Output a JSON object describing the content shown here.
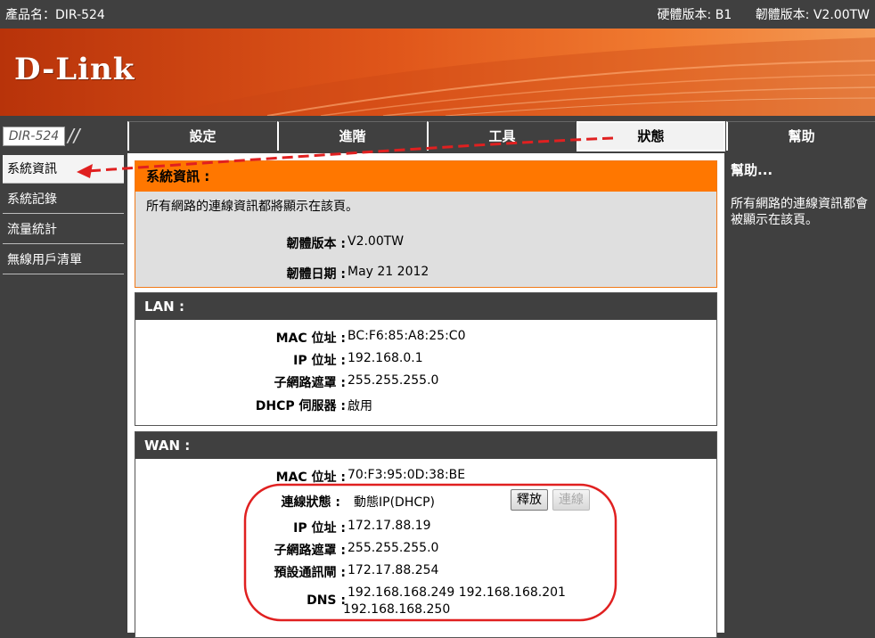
{
  "topbar": {
    "product_name": "產品名：DIR-524",
    "hardware_version": "硬體版本: B1",
    "firmware_version": "韌體版本: V2.00TW"
  },
  "brand": {
    "logo": "D-Link",
    "model_tag": "DIR-524"
  },
  "nav": {
    "tabs": [
      {
        "label": "設定"
      },
      {
        "label": "進階"
      },
      {
        "label": "工具"
      },
      {
        "label": "狀態"
      },
      {
        "label": "幫助"
      }
    ]
  },
  "sidebar": {
    "items": [
      {
        "label": "系統資訊"
      },
      {
        "label": "系統記錄"
      },
      {
        "label": "流量統計"
      },
      {
        "label": "無線用戶清單"
      }
    ]
  },
  "system_info": {
    "title": "系統資訊 :",
    "description": "所有網路的連線資訊都將顯示在該頁。",
    "fw_version_label": "韌體版本 :",
    "fw_version_value": "V2.00TW",
    "fw_date_label": "韌體日期 :",
    "fw_date_value": "May 21 2012"
  },
  "lan": {
    "title": "LAN :",
    "mac_label": "MAC 位址 :",
    "mac_value": "BC:F6:85:A8:25:C0",
    "ip_label": "IP 位址 :",
    "ip_value": "192.168.0.1",
    "mask_label": "子網路遮罩 :",
    "mask_value": "255.255.255.0",
    "dhcp_label": "DHCP 伺服器 :",
    "dhcp_value": "啟用"
  },
  "wan": {
    "title": "WAN :",
    "mac_label": "MAC 位址 :",
    "mac_value": "70:F3:95:0D:38:BE",
    "conn_label": "連線狀態 :",
    "conn_value": "動態IP(DHCP)",
    "release_button": "釋放",
    "connect_button": "連線",
    "ip_label": "IP 位址 :",
    "ip_value": "172.17.88.19",
    "mask_label": "子網路遮罩 :",
    "mask_value": "255.255.255.0",
    "gateway_label": "預設通訊閘 :",
    "gateway_value": "172.17.88.254",
    "dns_label": "DNS :",
    "dns_line1": "192.168.168.249 192.168.168.201",
    "dns_line2": "192.168.168.250"
  },
  "help": {
    "title": "幫助...",
    "text": "所有網路的連線資訊都會被顯示在該頁。"
  },
  "colors": {
    "accent_orange": "#ff7700",
    "dark_gray": "#404040",
    "annotation_red": "#e02020"
  }
}
